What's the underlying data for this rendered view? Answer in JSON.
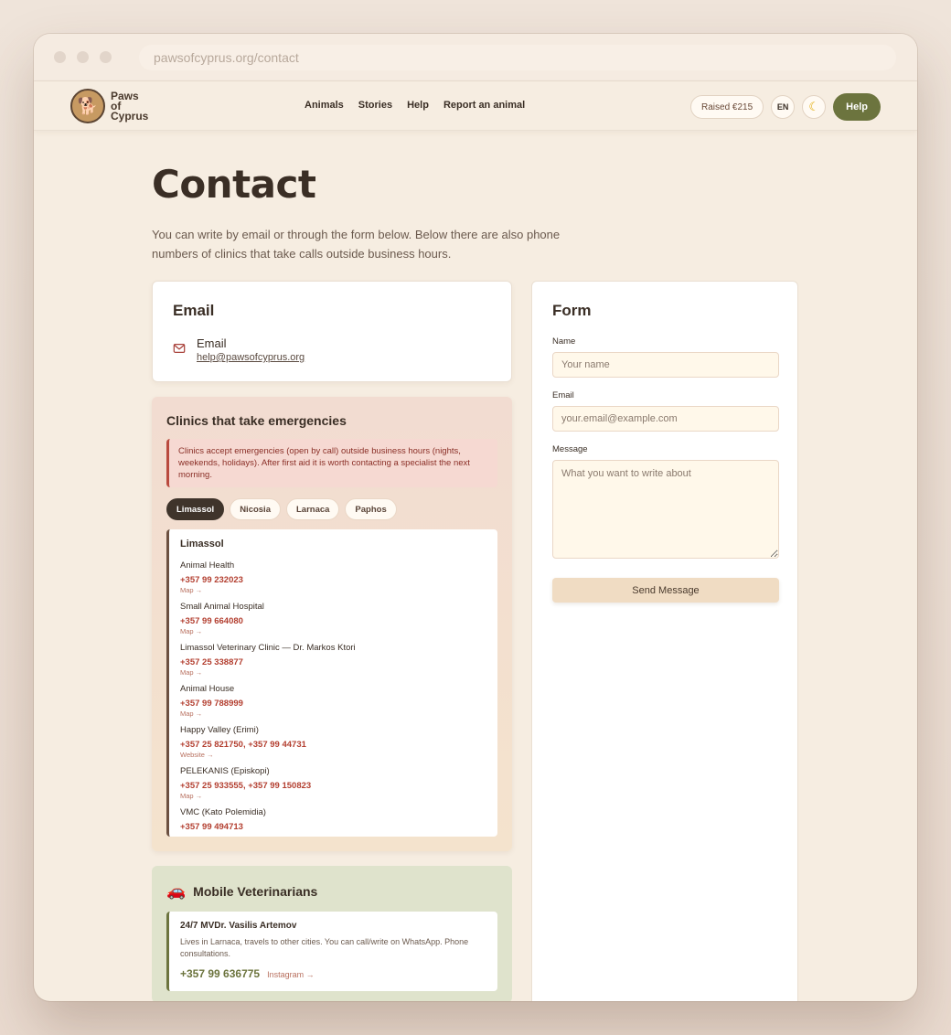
{
  "browser": {
    "url": "pawsofcyprus.org/contact"
  },
  "header": {
    "logo_lines": [
      "Paws",
      "of",
      "Cyprus"
    ],
    "nav": [
      "Animals",
      "Stories",
      "Help",
      "Report an animal"
    ],
    "raised": "Raised €215",
    "lang": "EN",
    "theme_icon": "☾",
    "help": "Help"
  },
  "page": {
    "title": "Contact",
    "intro": "You can write by email or through the form below. Below there are also phone numbers of clinics that take calls outside business hours."
  },
  "email_card": {
    "title": "Email",
    "label": "Email",
    "address": "help@pawsofcyprus.org"
  },
  "clinics": {
    "title": "Clinics that take emergencies",
    "warning": "Clinics accept emergencies (open by call) outside business hours (nights, weekends, holidays). After first aid it is worth contacting a specialist the next morning.",
    "tabs": [
      "Limassol",
      "Nicosia",
      "Larnaca",
      "Paphos"
    ],
    "active_city": "Limassol",
    "items": [
      {
        "name": "Animal Health",
        "phone": "+357 99 232023",
        "link": "Map →"
      },
      {
        "name": "Small Animal Hospital",
        "phone": "+357 99 664080",
        "link": "Map →"
      },
      {
        "name": "Limassol Veterinary Clinic — Dr. Markos Ktori",
        "phone": "+357 25 338877",
        "link": "Map →"
      },
      {
        "name": "Animal House",
        "phone": "+357 99 788999",
        "link": "Map →"
      },
      {
        "name": "Happy Valley (Erimi)",
        "phone": "+357 25 821750, +357 99 44731",
        "link": "Website →"
      },
      {
        "name": "PELEKANIS (Episkopi)",
        "phone": "+357 25 933555, +357 99 150823",
        "link": "Map →"
      },
      {
        "name": "VMC (Kato Polemidia)",
        "phone": "+357 99 494713",
        "link": ""
      }
    ]
  },
  "mobile": {
    "title": "Mobile Veterinarians",
    "vet_name": "24/7 MVDr. Vasilis Artemov",
    "vet_desc": "Lives in Larnaca, travels to other cities. You can call/write on WhatsApp. Phone consultations.",
    "vet_phone": "+357 99 636775",
    "vet_link": "Instagram →"
  },
  "form": {
    "title": "Form",
    "name_label": "Name",
    "name_placeholder": "Your name",
    "email_label": "Email",
    "email_placeholder": "your.email@example.com",
    "message_label": "Message",
    "message_placeholder": "What you want to write about",
    "submit": "Send Message"
  }
}
